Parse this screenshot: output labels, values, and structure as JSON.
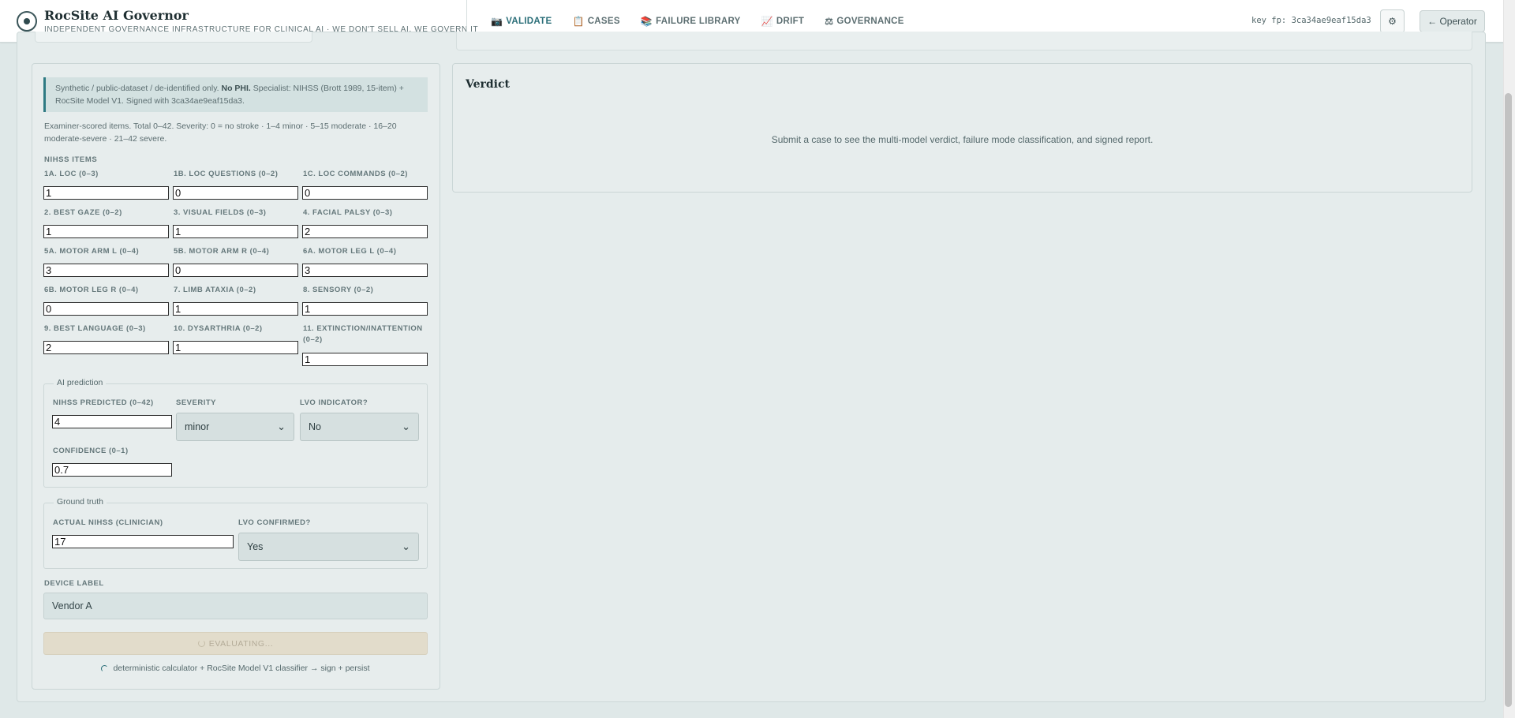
{
  "header": {
    "title": "RocSite AI Governor",
    "subtitle": "INDEPENDENT GOVERNANCE INFRASTRUCTURE FOR CLINICAL AI · WE DON'T SELL AI, WE GOVERN IT",
    "key_fp": "key fp: 3ca34ae9eaf15da3",
    "gear_glyph": "⚙",
    "operator_label": "← Operator"
  },
  "nav": {
    "tabs": [
      {
        "icon": "📷",
        "label": "VALIDATE",
        "active": true
      },
      {
        "icon": "📋",
        "label": "CASES"
      },
      {
        "icon": "📚",
        "label": "FAILURE LIBRARY"
      },
      {
        "icon": "📈",
        "label": "DRIFT"
      },
      {
        "icon": "⚖",
        "label": "GOVERNANCE"
      }
    ]
  },
  "form": {
    "notice_prefix": "Synthetic / public-dataset / de-identified only.",
    "notice_bold": "No PHI.",
    "notice_rest": "Specialist: NIHSS (Brott 1989, 15-item) + RocSite Model V1. Signed with 3ca34ae9eaf15da3.",
    "description": "Examiner-scored items. Total 0–42. Severity: 0 = no stroke · 1–4 minor · 5–15 moderate · 16–20 moderate-severe · 21–42 severe.",
    "items_heading": "NIHSS ITEMS",
    "items": [
      {
        "label": "1A. LOC (0–3)",
        "value": "1"
      },
      {
        "label": "1B. LOC QUESTIONS (0–2)",
        "value": "0"
      },
      {
        "label": "1C. LOC COMMANDS (0–2)",
        "value": "0"
      },
      {
        "label": "2. BEST GAZE (0–2)",
        "value": "1"
      },
      {
        "label": "3. VISUAL FIELDS (0–3)",
        "value": "1"
      },
      {
        "label": "4. FACIAL PALSY (0–3)",
        "value": "2"
      },
      {
        "label": "5A. MOTOR ARM L (0–4)",
        "value": "3"
      },
      {
        "label": "5B. MOTOR ARM R (0–4)",
        "value": "0"
      },
      {
        "label": "6A. MOTOR LEG L (0–4)",
        "value": "3"
      },
      {
        "label": "6B. MOTOR LEG R (0–4)",
        "value": "0"
      },
      {
        "label": "7. LIMB ATAXIA (0–2)",
        "value": "1"
      },
      {
        "label": "8. SENSORY (0–2)",
        "value": "1"
      },
      {
        "label": "9. BEST LANGUAGE (0–3)",
        "value": "2"
      },
      {
        "label": "10. DYSARTHRIA (0–2)",
        "value": "1"
      },
      {
        "label": "11. EXTINCTION/INATTENTION (0–2)",
        "value": "1"
      }
    ],
    "ai_prediction": {
      "legend": "AI prediction",
      "nihss_label": "NIHSS PREDICTED (0–42)",
      "nihss_value": "4",
      "severity_label": "SEVERITY",
      "severity_value": "minor",
      "lvo_label": "LVO INDICATOR?",
      "lvo_value": "No",
      "confidence_label": "CONFIDENCE (0–1)",
      "confidence_value": "0.7"
    },
    "ground_truth": {
      "legend": "Ground truth",
      "actual_label": "ACTUAL NIHSS (CLINICIAN)",
      "actual_value": "17",
      "lvo_confirmed_label": "LVO CONFIRMED?",
      "lvo_confirmed_value": "Yes"
    },
    "device_label": "DEVICE LABEL",
    "device_value": "Vendor A",
    "evaluate_label": "EVALUATING...",
    "progress_text": "deterministic calculator + RocSite Model V1 classifier → sign + persist"
  },
  "verdict": {
    "title": "Verdict",
    "message": "Submit a case to see the multi-model verdict, failure mode classification, and signed report."
  }
}
